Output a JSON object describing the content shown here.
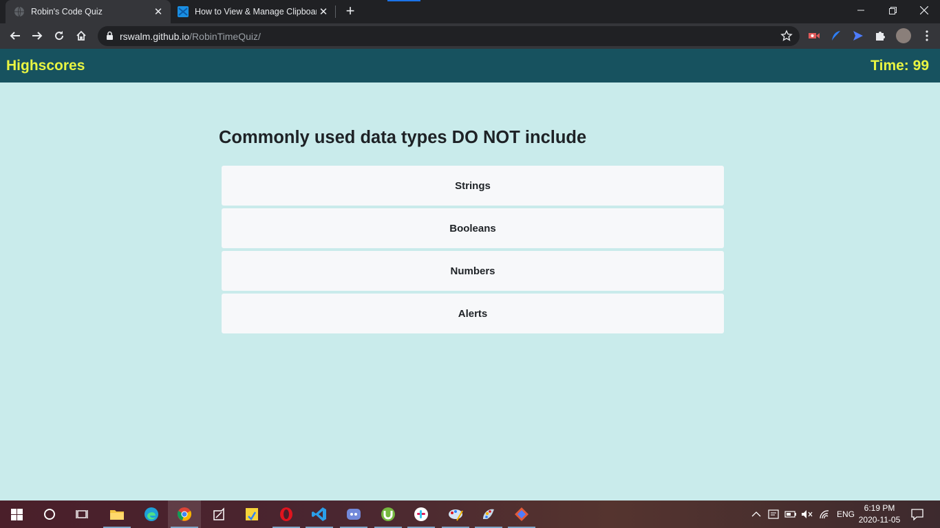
{
  "browser": {
    "tabs": [
      {
        "title": "Robin's Code Quiz",
        "active": true
      },
      {
        "title": "How to View & Manage Clipboard",
        "active": false
      }
    ],
    "url_host": "rswalm.github.io",
    "url_path": "/RobinTimeQuiz/"
  },
  "header": {
    "highscores_label": "Highscores",
    "time_label": "Time: ",
    "time_value": "99"
  },
  "quiz": {
    "question": "Commonly used data types DO NOT include",
    "answers": [
      "Strings",
      "Booleans",
      "Numbers",
      "Alerts"
    ]
  },
  "taskbar": {
    "apps": [
      "start-icon",
      "cortana-icon",
      "task-view-icon",
      "file-explorer-icon",
      "edge-icon",
      "chrome-icon",
      "notes-icon",
      "sticky-app-icon",
      "opera-icon",
      "vscode-icon",
      "discord-icon",
      "utorrent-icon",
      "slack-icon",
      "paint-icon",
      "paint-3d-icon",
      "git-icon"
    ],
    "language": "ENG",
    "time": "6:19 PM",
    "date": "2020-11-05"
  },
  "colors": {
    "header_bg": "#17525f",
    "header_text": "#e9f542",
    "page_bg": "#c9ebeb",
    "answer_bg": "#f7f8fa"
  }
}
